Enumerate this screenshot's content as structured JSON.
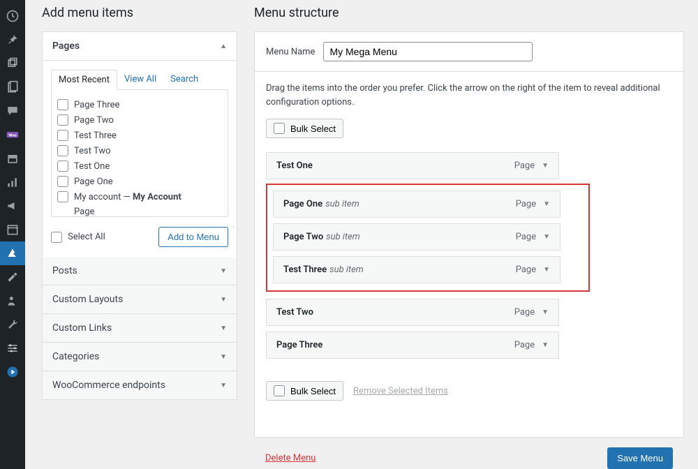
{
  "sidebar": {
    "icons": [
      "dashboard",
      "pin",
      "tools",
      "pages",
      "comments",
      "woo",
      "archive",
      "analytics",
      "megaphone",
      "calendar",
      "appearance",
      "wrench",
      "users",
      "settings",
      "sliders",
      "play"
    ]
  },
  "left": {
    "title": "Add menu items",
    "panels": {
      "pages": "Pages",
      "posts": "Posts",
      "customLayouts": "Custom Layouts",
      "customLinks": "Custom Links",
      "categories": "Categories",
      "wooEndpoints": "WooCommerce endpoints"
    },
    "tabs": {
      "recent": "Most Recent",
      "viewAll": "View All",
      "search": "Search"
    },
    "pageItems": [
      "Page Three",
      "Page Two",
      "Test Three",
      "Test Two",
      "Test One",
      "Page One",
      {
        "prefix": "My account — ",
        "bold": "My Account"
      },
      "Page"
    ],
    "selectAll": "Select All",
    "addToMenu": "Add to Menu"
  },
  "right": {
    "title": "Menu structure",
    "menuNameLabel": "Menu Name",
    "menuNameValue": "My Mega Menu",
    "instructions": "Drag the items into the order you prefer. Click the arrow on the right of the item to reveal additional configuration options.",
    "bulkSelect": "Bulk Select",
    "removeSelected": "Remove Selected Items",
    "items": [
      {
        "title": "Test One",
        "type": "Page",
        "sub": false
      },
      {
        "title": "Page One",
        "type": "Page",
        "sub": true,
        "subLabel": "sub item"
      },
      {
        "title": "Page Two",
        "type": "Page",
        "sub": true,
        "subLabel": "sub item"
      },
      {
        "title": "Test Three",
        "type": "Page",
        "sub": true,
        "subLabel": "sub item"
      },
      {
        "title": "Test Two",
        "type": "Page",
        "sub": false
      },
      {
        "title": "Page Three",
        "type": "Page",
        "sub": false
      }
    ],
    "deleteMenu": "Delete Menu",
    "saveMenu": "Save Menu"
  }
}
